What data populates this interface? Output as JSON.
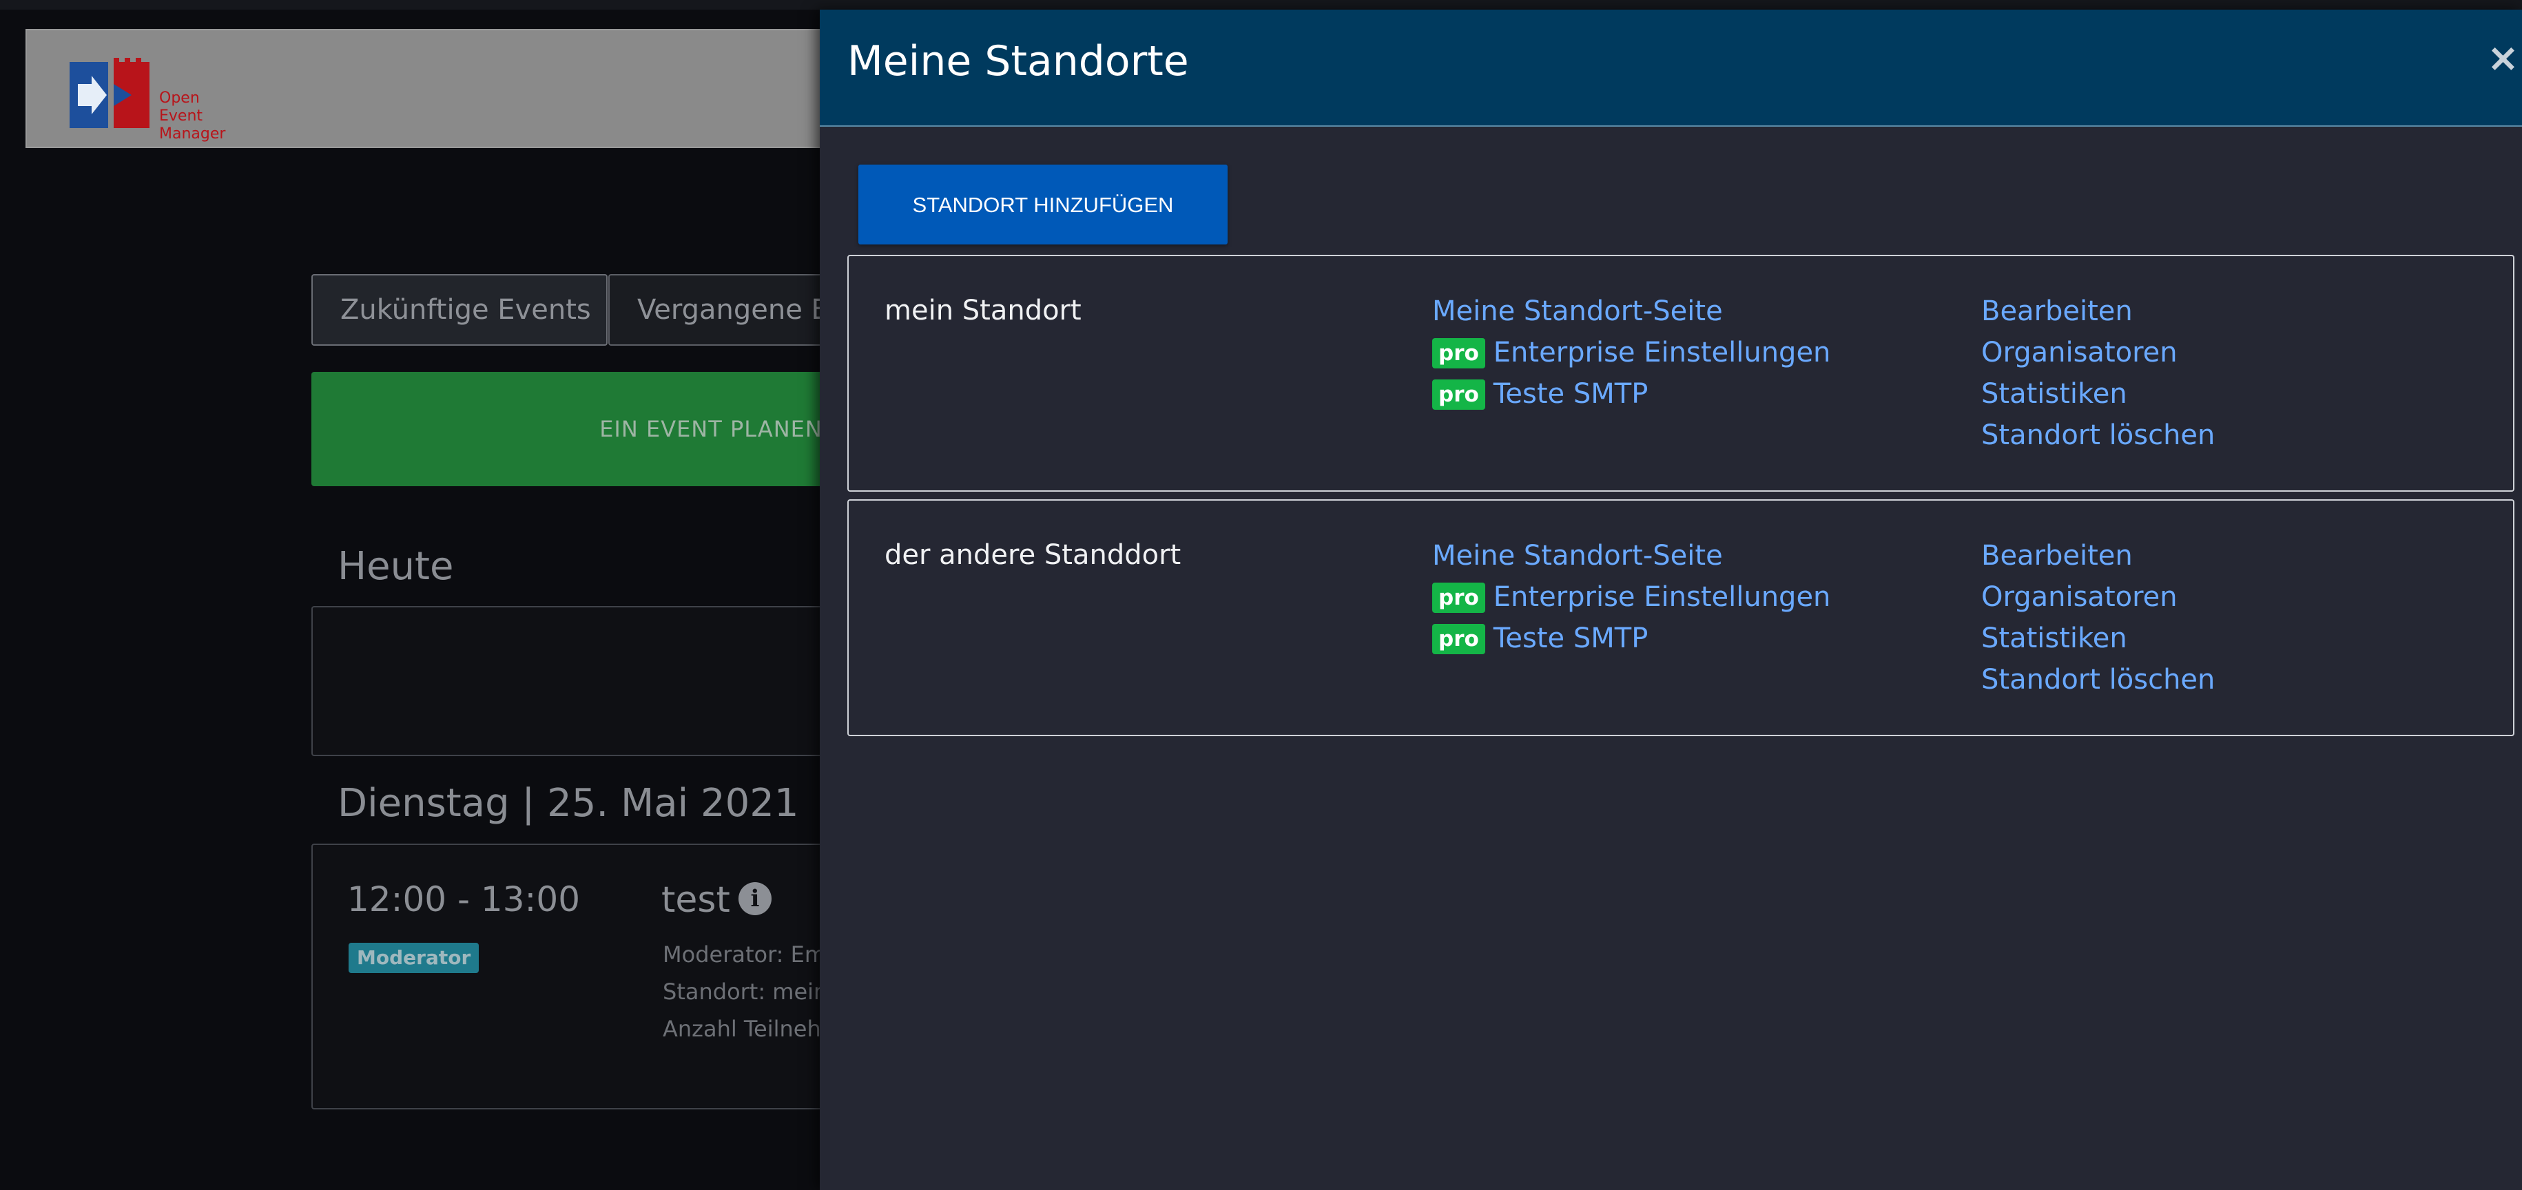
{
  "app": {
    "logo_lines": [
      "Open",
      "Event",
      "Manager"
    ]
  },
  "tabs": [
    {
      "label": "Zukünftige Events"
    },
    {
      "label": "Vergangene Events"
    }
  ],
  "plan_button_label": "EIN EVENT PLANEN",
  "sections": {
    "today": "Heute",
    "date": "Dienstag | 25. Mai 2021"
  },
  "event": {
    "time": "12:00 - 13:00",
    "badge": "Moderator",
    "title": "test",
    "info_icon": "info-icon",
    "moderator_line": "Moderator: Em",
    "location_line": "Standort: mein",
    "participants_line": "Anzahl Teilneh"
  },
  "modal": {
    "title": "Meine Standorte",
    "close_glyph": "×",
    "add_button": "STANDORT HINZUFÜGEN",
    "pro_badge": "pro",
    "locations": [
      {
        "name": "mein Standort",
        "links_mid": [
          "Meine Standort-Seite",
          "Enterprise Einstellungen",
          "Teste SMTP"
        ],
        "links_right": [
          "Bearbeiten",
          "Organisatoren",
          "Statistiken",
          "Standort löschen"
        ]
      },
      {
        "name": "der andere Standdort",
        "links_mid": [
          "Meine Standort-Seite",
          "Enterprise Einstellungen",
          "Teste SMTP"
        ],
        "links_right": [
          "Bearbeiten",
          "Organisatoren",
          "Statistiken",
          "Standort löschen"
        ]
      }
    ]
  },
  "colors": {
    "modal_header": "#003a5e",
    "primary_button": "#0059b8",
    "link": "#6aa9ff",
    "pro_badge": "#14b547",
    "plan_button": "#1f7a35"
  }
}
